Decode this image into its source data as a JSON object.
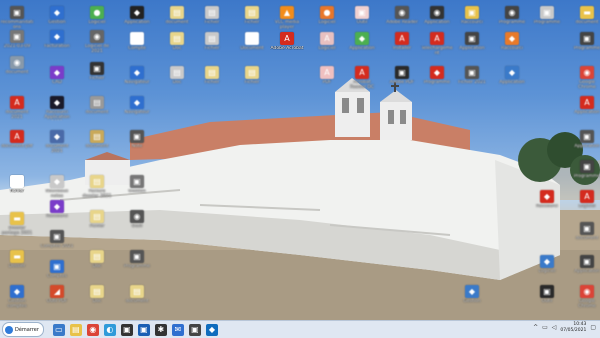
{
  "desktop": {
    "icons": [
      {
        "label": "recommandations",
        "icon": "app-icon",
        "color": "#555555",
        "glyph": "▣",
        "blur": true
      },
      {
        "label": "2021-03-09",
        "icon": "app-icon",
        "color": "#777777",
        "glyph": "▣",
        "blur": true
      },
      {
        "label": "document",
        "icon": "app-icon",
        "color": "#8899aa",
        "glyph": "◉",
        "blur": true
      },
      {
        "label": "document 2021",
        "icon": "pdf-icon",
        "color": "#d42b1e",
        "glyph": "A",
        "blur": true
      },
      {
        "label": "document pdf",
        "icon": "pdf-icon",
        "color": "#d42b1e",
        "glyph": "A",
        "blur": true
      },
      {
        "label": "fichier",
        "icon": "file-icon",
        "color": "#ffffff",
        "glyph": "▤",
        "blur": false
      },
      {
        "label": "Dossier partage 2021 pro",
        "icon": "folder-icon",
        "color": "#e8c24a",
        "glyph": "▬",
        "blur": true
      },
      {
        "label": "Dossier",
        "icon": "folder-icon",
        "color": "#e8c24a",
        "glyph": "▬",
        "blur": true
      },
      {
        "label": "Gestion comptes",
        "icon": "app-icon",
        "color": "#2f6fcf",
        "glyph": "◆",
        "blur": true
      },
      {
        "label": "Gestion",
        "icon": "app-icon",
        "color": "#2f6fcf",
        "glyph": "◆",
        "blur": true
      },
      {
        "label": "Facturation",
        "icon": "app-icon",
        "color": "#2f6fcf",
        "glyph": "◆",
        "blur": true
      },
      {
        "label": "CAD",
        "icon": "app-icon",
        "color": "#7a3cc9",
        "glyph": "◆",
        "blur": true
      },
      {
        "label": "Raccourci Application 2021",
        "icon": "app-icon",
        "color": "#1a1a2a",
        "glyph": "◆",
        "blur": true
      },
      {
        "label": "document 2021",
        "icon": "app-icon",
        "color": "#4a6aa8",
        "glyph": "◆",
        "blur": true
      },
      {
        "label": "Nouveaux notes",
        "icon": "app-icon",
        "color": "#c9c9c9",
        "glyph": "◆",
        "blur": true
      },
      {
        "label": "Raccourci",
        "icon": "app-icon",
        "color": "#7a3cc9",
        "glyph": "◆",
        "blur": true
      },
      {
        "label": "Comptes 2021",
        "icon": "app-icon",
        "color": "#555555",
        "glyph": "▣",
        "blur": true
      },
      {
        "label": "Comptes",
        "icon": "app-icon",
        "color": "#2f6fcf",
        "glyph": "▣",
        "blur": true
      },
      {
        "label": "Outil PDF",
        "icon": "app-icon",
        "color": "#d44a2a",
        "glyph": "◢",
        "blur": true
      },
      {
        "label": "Logiciel",
        "icon": "app-icon",
        "color": "#4caf50",
        "glyph": "●",
        "blur": true
      },
      {
        "label": "Logiciel de 2021",
        "icon": "app-icon",
        "color": "#666666",
        "glyph": "◉",
        "blur": true
      },
      {
        "label": "Fichier",
        "icon": "app-icon",
        "color": "#333333",
        "glyph": "▣",
        "blur": true
      },
      {
        "label": "document",
        "icon": "file-icon",
        "color": "#999999",
        "glyph": "▤",
        "blur": true
      },
      {
        "label": "document",
        "icon": "file-icon",
        "color": "#c9a95a",
        "glyph": "▤",
        "blur": true
      },
      {
        "label": "Facture dossier 2021",
        "icon": "file-icon",
        "color": "#e8d58a",
        "glyph": "▤",
        "blur": true
      },
      {
        "label": "Fichier",
        "icon": "file-icon",
        "color": "#e8d58a",
        "glyph": "▤",
        "blur": true
      },
      {
        "label": "Doc",
        "icon": "file-icon",
        "color": "#e8d58a",
        "glyph": "▤",
        "blur": true
      },
      {
        "label": "Doc",
        "icon": "file-icon",
        "color": "#e8d58a",
        "glyph": "▤",
        "blur": true
      },
      {
        "label": "Application",
        "icon": "app-icon",
        "color": "#222222",
        "glyph": "◆",
        "blur": true
      },
      {
        "label": "Compte",
        "icon": "app-icon",
        "color": "#ffffff",
        "glyph": "◆",
        "blur": true
      },
      {
        "label": "Navigateur",
        "icon": "app-icon",
        "color": "#2f6fcf",
        "glyph": "◆",
        "blur": true
      },
      {
        "label": "Navigateur",
        "icon": "app-icon",
        "color": "#2f6fcf",
        "glyph": "◆",
        "blur": true
      },
      {
        "label": "Note",
        "icon": "app-icon",
        "color": "#555555",
        "glyph": "▣",
        "blur": true
      },
      {
        "label": "Gestion",
        "icon": "app-icon",
        "color": "#777777",
        "glyph": "▣",
        "blur": true
      },
      {
        "label": "Outil",
        "icon": "app-icon",
        "color": "#555555",
        "glyph": "◉",
        "blur": true
      },
      {
        "label": "Programme",
        "icon": "app-icon",
        "color": "#555555",
        "glyph": "▣",
        "blur": true
      },
      {
        "label": "document",
        "icon": "file-icon",
        "color": "#e8d58a",
        "glyph": "▤",
        "blur": true
      },
      {
        "label": "document",
        "icon": "file-icon",
        "color": "#e8d58a",
        "glyph": "▤",
        "blur": true
      },
      {
        "label": "Doc",
        "icon": "file-icon",
        "color": "#e8d58a",
        "glyph": "▤",
        "blur": true
      },
      {
        "label": "Doc",
        "icon": "file-icon",
        "color": "#c9c9c9",
        "glyph": "▤",
        "blur": true
      },
      {
        "label": "Fichier",
        "icon": "file-icon",
        "color": "#c9c9c9",
        "glyph": "▤",
        "blur": true
      },
      {
        "label": "Fichier",
        "icon": "file-icon",
        "color": "#c9c9c9",
        "glyph": "▤",
        "blur": true
      },
      {
        "label": "Fichier",
        "icon": "file-icon",
        "color": "#e8d58a",
        "glyph": "▤",
        "blur": true
      },
      {
        "label": "Fichier",
        "icon": "file-icon",
        "color": "#e8d58a",
        "glyph": "▤",
        "blur": true
      },
      {
        "label": "Document",
        "icon": "file-icon",
        "color": "#ffffff",
        "glyph": "▤",
        "blur": true
      },
      {
        "label": "Fichier",
        "icon": "file-icon",
        "color": "#e8d58a",
        "glyph": "▤",
        "blur": true
      },
      {
        "label": "VLC media player",
        "icon": "vlc-icon",
        "color": "#f28c1b",
        "glyph": "▲",
        "blur": true
      },
      {
        "label": "Adobe Acrobat",
        "icon": "acrobat-icon",
        "color": "#d42b1e",
        "glyph": "A",
        "blur": false
      },
      {
        "label": "Logiciel",
        "icon": "app-icon",
        "color": "#e8762a",
        "glyph": "●",
        "blur": true
      },
      {
        "label": "Logiciel",
        "icon": "app-icon",
        "color": "#e8c0c0",
        "glyph": "A",
        "blur": true
      },
      {
        "label": "PDF",
        "icon": "pdf-icon",
        "color": "#f0c0c0",
        "glyph": "A",
        "blur": true
      },
      {
        "label": "Outil",
        "icon": "app-icon",
        "color": "#f0d0d0",
        "glyph": "▣",
        "blur": true
      },
      {
        "label": "Application",
        "icon": "app-icon",
        "color": "#4caf50",
        "glyph": "◆",
        "blur": true
      },
      {
        "label": "Acrobat Reader DC",
        "icon": "acrobat-icon",
        "color": "#d42b1e",
        "glyph": "A",
        "blur": true
      },
      {
        "label": "Adobe Reader",
        "icon": "wifi-icon",
        "color": "#555555",
        "glyph": "◉",
        "blur": true
      },
      {
        "label": "Installer",
        "icon": "pdf-icon",
        "color": "#d42b1e",
        "glyph": "A",
        "blur": true
      },
      {
        "label": "Adobe PDF",
        "icon": "app-icon",
        "color": "#2a2a2a",
        "glyph": "▣",
        "blur": true
      },
      {
        "label": "Application",
        "icon": "app-icon",
        "color": "#333333",
        "glyph": "◉",
        "blur": true
      },
      {
        "label": "Telechargement",
        "icon": "pdf-icon",
        "color": "#d42b1e",
        "glyph": "A",
        "blur": true
      },
      {
        "label": "Programme",
        "icon": "app-icon",
        "color": "#d42b1e",
        "glyph": "◆",
        "blur": true
      },
      {
        "label": "Raccourci",
        "icon": "app-icon",
        "color": "#e8c24a",
        "glyph": "▣",
        "blur": true
      },
      {
        "label": "Application",
        "icon": "app-icon",
        "color": "#444444",
        "glyph": "▣",
        "blur": true
      },
      {
        "label": "Fichier 2021",
        "icon": "app-icon",
        "color": "#555555",
        "glyph": "▣",
        "blur": true
      },
      {
        "label": "Gestion",
        "icon": "app-icon",
        "color": "#3a7ac9",
        "glyph": "◆",
        "blur": true
      },
      {
        "label": "Programme",
        "icon": "app-icon",
        "color": "#444444",
        "glyph": "◉",
        "blur": true
      },
      {
        "label": "Raccourci",
        "icon": "app-icon",
        "color": "#e87a2a",
        "glyph": "◆",
        "blur": true
      },
      {
        "label": "Application",
        "icon": "app-icon",
        "color": "#3a7ac9",
        "glyph": "◆",
        "blur": true
      },
      {
        "label": "Programme",
        "icon": "app-icon",
        "color": "#c9c9c9",
        "glyph": "▣",
        "blur": true
      },
      {
        "label": "Raccourci",
        "icon": "app-icon",
        "color": "#d42b1e",
        "glyph": "◆",
        "blur": true
      },
      {
        "label": "Logiciel",
        "icon": "app-icon",
        "color": "#3a7ac9",
        "glyph": "◆",
        "blur": true
      },
      {
        "label": "Outil",
        "icon": "app-icon",
        "color": "#2a2a2a",
        "glyph": "▣",
        "blur": true
      },
      {
        "label": "document",
        "icon": "app-icon",
        "color": "#e8c24a",
        "glyph": "▬",
        "blur": true
      },
      {
        "label": "Programme",
        "icon": "app-icon",
        "color": "#444444",
        "glyph": "▣",
        "blur": true
      },
      {
        "label": "Google Chrome",
        "icon": "chrome-icon",
        "color": "#db4437",
        "glyph": "◉",
        "blur": true
      },
      {
        "label": "Application",
        "icon": "app-icon",
        "color": "#d42b1e",
        "glyph": "A",
        "blur": true
      },
      {
        "label": "Application",
        "icon": "app-icon",
        "color": "#555555",
        "glyph": "▣",
        "blur": true
      },
      {
        "label": "Programme",
        "icon": "app-icon",
        "color": "#444444",
        "glyph": "▣",
        "blur": true
      },
      {
        "label": "Logiciel",
        "icon": "app-icon",
        "color": "#d42b1e",
        "glyph": "A",
        "blur": true
      },
      {
        "label": "document",
        "icon": "app-icon",
        "color": "#555555",
        "glyph": "▣",
        "blur": true
      },
      {
        "label": "Application",
        "icon": "app-icon",
        "color": "#444444",
        "glyph": "▣",
        "blur": true
      },
      {
        "label": "Google Chrome",
        "icon": "chrome-icon",
        "color": "#db4437",
        "glyph": "◉",
        "blur": true
      },
      {
        "label": "Mini Messenger",
        "icon": "app-icon",
        "color": "#3a7ac9",
        "glyph": "◆",
        "blur": true
      },
      {
        "label": "Fichier",
        "icon": "app-icon",
        "color": "#3a7ac9",
        "glyph": "◆",
        "blur": true
      },
      {
        "label": "Logiciel",
        "icon": "app-icon",
        "color": "#c9c9c9",
        "glyph": "▣",
        "blur": true
      },
      {
        "label": "Application",
        "icon": "app-icon",
        "color": "#e8c24a",
        "glyph": "◆",
        "blur": true
      },
      {
        "label": "Programme",
        "icon": "app-icon",
        "color": "#3a7ac9",
        "glyph": "◆",
        "blur": true
      },
      {
        "label": "Fichier",
        "icon": "app-icon",
        "color": "#3a7ac9",
        "glyph": "◆",
        "blur": true
      },
      {
        "label": "Application",
        "icon": "app-icon",
        "color": "#2a2a2a",
        "glyph": "◉",
        "blur": true
      },
      {
        "label": "Reseau",
        "icon": "app-icon",
        "color": "#3a7ac9",
        "glyph": "◆",
        "blur": true
      },
      {
        "label": "Zoom",
        "icon": "app-icon",
        "color": "#3a7ac9",
        "glyph": "◆",
        "blur": true
      },
      {
        "label": "Fichier",
        "icon": "app-icon",
        "color": "#3a7ac9",
        "glyph": "◆",
        "blur": true
      }
    ]
  },
  "taskbar": {
    "start_label": "Démarrer",
    "apps": [
      {
        "name": "file-explorer-icon",
        "color": "#3a7ac9",
        "glyph": "▭"
      },
      {
        "name": "notes-icon",
        "color": "#e8c24a",
        "glyph": "▤"
      },
      {
        "name": "chrome-icon",
        "color": "#db4437",
        "glyph": "◉"
      },
      {
        "name": "edge-icon",
        "color": "#2f9bd9",
        "glyph": "◐"
      },
      {
        "name": "terminal-icon",
        "color": "#333333",
        "glyph": "▣"
      },
      {
        "name": "app-icon",
        "color": "#1a5fb4",
        "glyph": "▣"
      },
      {
        "name": "settings-icon",
        "color": "#333333",
        "glyph": "✱"
      },
      {
        "name": "mail-icon",
        "color": "#2f6fcf",
        "glyph": "✉"
      },
      {
        "name": "app-icon",
        "color": "#444444",
        "glyph": "▣"
      },
      {
        "name": "outlook-icon",
        "color": "#0f6cbd",
        "glyph": "◆"
      }
    ],
    "time": "10:43",
    "date": "07/05/2021",
    "tray_icons": [
      "chevron-up-icon",
      "network-icon",
      "volume-icon",
      "notifications-icon"
    ]
  }
}
